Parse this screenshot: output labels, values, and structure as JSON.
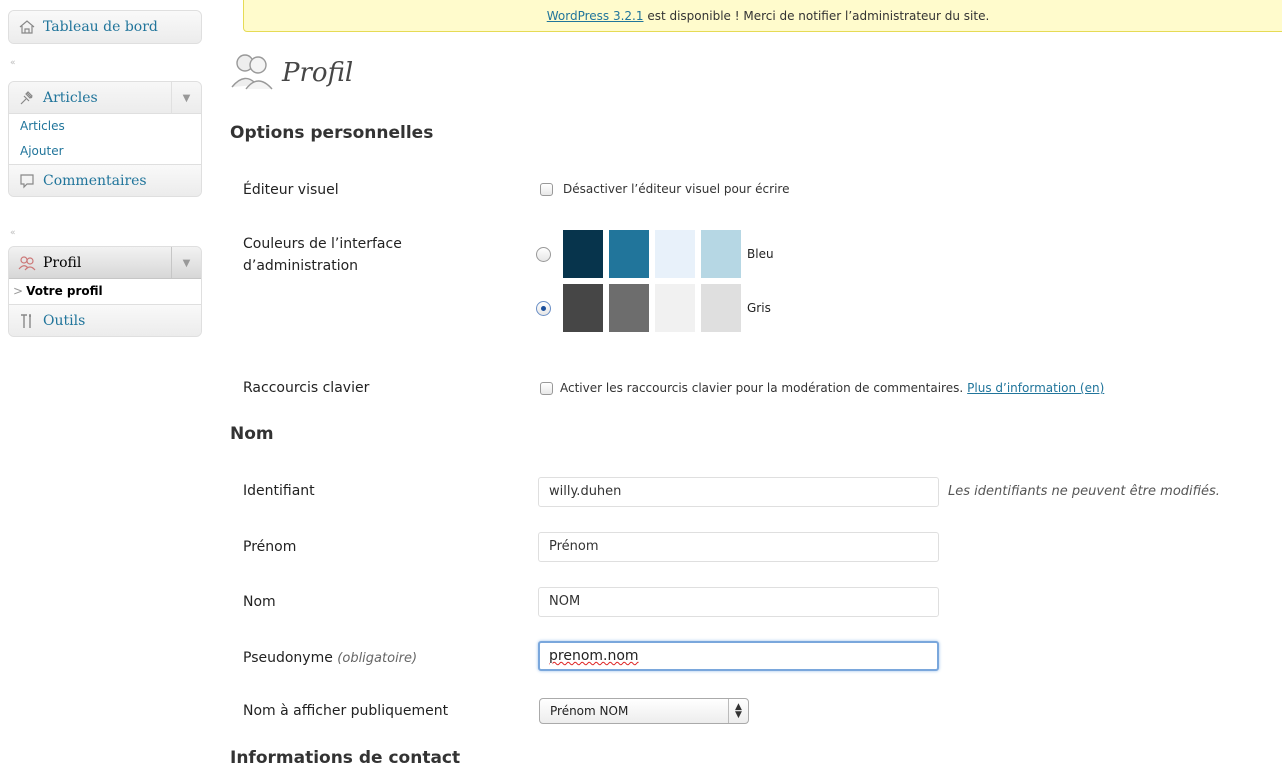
{
  "sidebar": {
    "dashboard_label": "Tableau de bord",
    "articles": {
      "label": "Articles",
      "items": [
        "Articles",
        "Ajouter"
      ]
    },
    "comments_label": "Commentaires",
    "profile": {
      "label": "Profil",
      "current_item": "Votre profil"
    },
    "tools_label": "Outils",
    "collapse_glyph": "«",
    "toggle_glyph": "▼",
    "current_arrow": ">"
  },
  "notice": {
    "link_text": "WordPress 3.2.1",
    "text": " est disponible ! Merci de notifier l’administrateur du site."
  },
  "page": {
    "title": "Profil"
  },
  "personal_options": {
    "heading": "Options personnelles",
    "visual_editor": {
      "label": "Éditeur visuel",
      "checkbox_label": "Désactiver l’éditeur visuel pour écrire"
    },
    "admin_colors": {
      "label_line1": "Couleurs de l’interface",
      "label_line2": "d’administration",
      "schemes": [
        {
          "name": "Bleu",
          "colors": [
            "#07344c",
            "#21759b",
            "#e8f1fa",
            "#b6d7e4"
          ]
        },
        {
          "name": "Gris",
          "colors": [
            "#464646",
            "#6d6d6d",
            "#f1f1f1",
            "#dfdfdf"
          ]
        }
      ],
      "selected": "Gris"
    },
    "keyboard_shortcuts": {
      "label": "Raccourcis clavier",
      "checkbox_label": "Activer les raccourcis clavier pour la modération de commentaires.",
      "link_text": "Plus d’information (en)"
    }
  },
  "name_section": {
    "heading": "Nom",
    "username": {
      "label": "Identifiant",
      "value": "willy.duhen",
      "hint": "Les identifiants ne peuvent être modifiés."
    },
    "first_name": {
      "label": "Prénom",
      "value": "Prénom"
    },
    "last_name": {
      "label": "Nom",
      "value": "NOM"
    },
    "nickname": {
      "label": "Pseudonyme",
      "required": "(obligatoire)",
      "value": "prenom.nom"
    },
    "display_name": {
      "label": "Nom à afficher publiquement",
      "value": "Prénom NOM"
    }
  },
  "contact_section": {
    "heading": "Informations de contact"
  },
  "colors": {
    "link": "#21759b",
    "notice_bg": "#fffbcc",
    "notice_border": "#e6db55"
  }
}
